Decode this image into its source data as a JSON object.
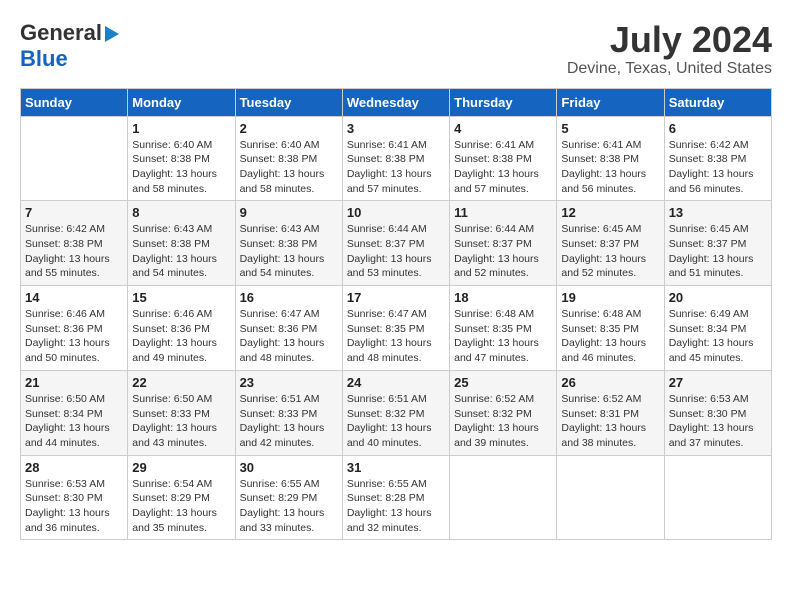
{
  "header": {
    "logo_line1": "General",
    "logo_line2": "Blue",
    "title": "July 2024",
    "subtitle": "Devine, Texas, United States"
  },
  "calendar": {
    "days_of_week": [
      "Sunday",
      "Monday",
      "Tuesday",
      "Wednesday",
      "Thursday",
      "Friday",
      "Saturday"
    ],
    "weeks": [
      [
        {
          "day": "",
          "info": ""
        },
        {
          "day": "1",
          "info": "Sunrise: 6:40 AM\nSunset: 8:38 PM\nDaylight: 13 hours\nand 58 minutes."
        },
        {
          "day": "2",
          "info": "Sunrise: 6:40 AM\nSunset: 8:38 PM\nDaylight: 13 hours\nand 58 minutes."
        },
        {
          "day": "3",
          "info": "Sunrise: 6:41 AM\nSunset: 8:38 PM\nDaylight: 13 hours\nand 57 minutes."
        },
        {
          "day": "4",
          "info": "Sunrise: 6:41 AM\nSunset: 8:38 PM\nDaylight: 13 hours\nand 57 minutes."
        },
        {
          "day": "5",
          "info": "Sunrise: 6:41 AM\nSunset: 8:38 PM\nDaylight: 13 hours\nand 56 minutes."
        },
        {
          "day": "6",
          "info": "Sunrise: 6:42 AM\nSunset: 8:38 PM\nDaylight: 13 hours\nand 56 minutes."
        }
      ],
      [
        {
          "day": "7",
          "info": "Sunrise: 6:42 AM\nSunset: 8:38 PM\nDaylight: 13 hours\nand 55 minutes."
        },
        {
          "day": "8",
          "info": "Sunrise: 6:43 AM\nSunset: 8:38 PM\nDaylight: 13 hours\nand 54 minutes."
        },
        {
          "day": "9",
          "info": "Sunrise: 6:43 AM\nSunset: 8:38 PM\nDaylight: 13 hours\nand 54 minutes."
        },
        {
          "day": "10",
          "info": "Sunrise: 6:44 AM\nSunset: 8:37 PM\nDaylight: 13 hours\nand 53 minutes."
        },
        {
          "day": "11",
          "info": "Sunrise: 6:44 AM\nSunset: 8:37 PM\nDaylight: 13 hours\nand 52 minutes."
        },
        {
          "day": "12",
          "info": "Sunrise: 6:45 AM\nSunset: 8:37 PM\nDaylight: 13 hours\nand 52 minutes."
        },
        {
          "day": "13",
          "info": "Sunrise: 6:45 AM\nSunset: 8:37 PM\nDaylight: 13 hours\nand 51 minutes."
        }
      ],
      [
        {
          "day": "14",
          "info": "Sunrise: 6:46 AM\nSunset: 8:36 PM\nDaylight: 13 hours\nand 50 minutes."
        },
        {
          "day": "15",
          "info": "Sunrise: 6:46 AM\nSunset: 8:36 PM\nDaylight: 13 hours\nand 49 minutes."
        },
        {
          "day": "16",
          "info": "Sunrise: 6:47 AM\nSunset: 8:36 PM\nDaylight: 13 hours\nand 48 minutes."
        },
        {
          "day": "17",
          "info": "Sunrise: 6:47 AM\nSunset: 8:35 PM\nDaylight: 13 hours\nand 48 minutes."
        },
        {
          "day": "18",
          "info": "Sunrise: 6:48 AM\nSunset: 8:35 PM\nDaylight: 13 hours\nand 47 minutes."
        },
        {
          "day": "19",
          "info": "Sunrise: 6:48 AM\nSunset: 8:35 PM\nDaylight: 13 hours\nand 46 minutes."
        },
        {
          "day": "20",
          "info": "Sunrise: 6:49 AM\nSunset: 8:34 PM\nDaylight: 13 hours\nand 45 minutes."
        }
      ],
      [
        {
          "day": "21",
          "info": "Sunrise: 6:50 AM\nSunset: 8:34 PM\nDaylight: 13 hours\nand 44 minutes."
        },
        {
          "day": "22",
          "info": "Sunrise: 6:50 AM\nSunset: 8:33 PM\nDaylight: 13 hours\nand 43 minutes."
        },
        {
          "day": "23",
          "info": "Sunrise: 6:51 AM\nSunset: 8:33 PM\nDaylight: 13 hours\nand 42 minutes."
        },
        {
          "day": "24",
          "info": "Sunrise: 6:51 AM\nSunset: 8:32 PM\nDaylight: 13 hours\nand 40 minutes."
        },
        {
          "day": "25",
          "info": "Sunrise: 6:52 AM\nSunset: 8:32 PM\nDaylight: 13 hours\nand 39 minutes."
        },
        {
          "day": "26",
          "info": "Sunrise: 6:52 AM\nSunset: 8:31 PM\nDaylight: 13 hours\nand 38 minutes."
        },
        {
          "day": "27",
          "info": "Sunrise: 6:53 AM\nSunset: 8:30 PM\nDaylight: 13 hours\nand 37 minutes."
        }
      ],
      [
        {
          "day": "28",
          "info": "Sunrise: 6:53 AM\nSunset: 8:30 PM\nDaylight: 13 hours\nand 36 minutes."
        },
        {
          "day": "29",
          "info": "Sunrise: 6:54 AM\nSunset: 8:29 PM\nDaylight: 13 hours\nand 35 minutes."
        },
        {
          "day": "30",
          "info": "Sunrise: 6:55 AM\nSunset: 8:29 PM\nDaylight: 13 hours\nand 33 minutes."
        },
        {
          "day": "31",
          "info": "Sunrise: 6:55 AM\nSunset: 8:28 PM\nDaylight: 13 hours\nand 32 minutes."
        },
        {
          "day": "",
          "info": ""
        },
        {
          "day": "",
          "info": ""
        },
        {
          "day": "",
          "info": ""
        }
      ]
    ]
  }
}
